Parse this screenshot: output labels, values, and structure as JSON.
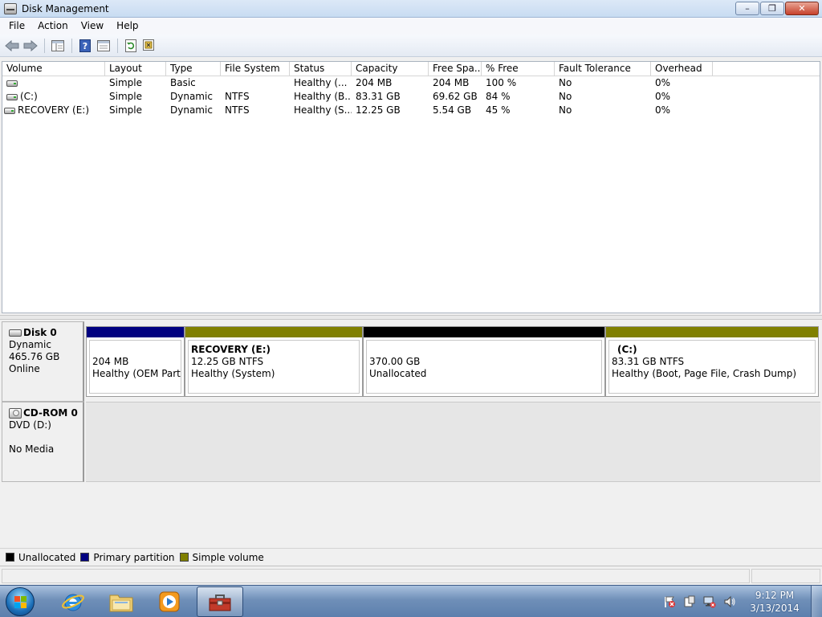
{
  "window": {
    "title": "Disk Management",
    "minimize_label": "–",
    "maximize_label": "❐",
    "close_label": "✕"
  },
  "menu": [
    "File",
    "Action",
    "View",
    "Help"
  ],
  "toolbar": {
    "icons": [
      "back-arrow-icon",
      "forward-arrow-icon",
      "show-hide-tree-icon",
      "help-icon",
      "properties-icon",
      "refresh-icon",
      "rescan-disks-icon"
    ]
  },
  "volume_list": {
    "columns": [
      "Volume",
      "Layout",
      "Type",
      "File System",
      "Status",
      "Capacity",
      "Free Spa...",
      "% Free",
      "Fault Tolerance",
      "Overhead"
    ],
    "rows": [
      {
        "volume": "",
        "layout": "Simple",
        "type": "Basic",
        "fs": "",
        "status": "Healthy (...",
        "capacity": "204 MB",
        "free": "204 MB",
        "pct_free": "100 %",
        "fault": "No",
        "overhead": "0%"
      },
      {
        "volume": "(C:)",
        "layout": "Simple",
        "type": "Dynamic",
        "fs": "NTFS",
        "status": "Healthy (B...",
        "capacity": "83.31 GB",
        "free": "69.62 GB",
        "pct_free": "84 %",
        "fault": "No",
        "overhead": "0%"
      },
      {
        "volume": "RECOVERY (E:)",
        "layout": "Simple",
        "type": "Dynamic",
        "fs": "NTFS",
        "status": "Healthy (S...",
        "capacity": "12.25 GB",
        "free": "5.54 GB",
        "pct_free": "45 %",
        "fault": "No",
        "overhead": "0%"
      }
    ]
  },
  "disks": [
    {
      "name": "Disk 0",
      "type": "Dynamic",
      "size": "465.76 GB",
      "state": "Online",
      "partitions": [
        {
          "title": "",
          "line1": "204 MB",
          "line2": "Healthy (OEM Partiti",
          "kind": "primary"
        },
        {
          "title": "RECOVERY  (E:)",
          "line1": "12.25 GB NTFS",
          "line2": "Healthy (System)",
          "kind": "simple"
        },
        {
          "title": "",
          "line1": "370.00 GB",
          "line2": "Unallocated",
          "kind": "unallocated"
        },
        {
          "title": "(C:)",
          "line1": "83.31 GB NTFS",
          "line2": "Healthy (Boot, Page File, Crash Dump)",
          "kind": "simple"
        }
      ]
    },
    {
      "name": "CD-ROM 0",
      "type": "DVD (D:)",
      "size": "",
      "state": "No Media",
      "partitions": []
    }
  ],
  "legend": [
    {
      "label": "Unallocated",
      "color": "#000000"
    },
    {
      "label": "Primary partition",
      "color": "#000080"
    },
    {
      "label": "Simple volume",
      "color": "#808000"
    }
  ],
  "colors": {
    "unallocated": "#000000",
    "primary": "#000080",
    "simple": "#808000"
  },
  "taskbar": {
    "apps": [
      "internet-explorer-icon",
      "windows-explorer-icon",
      "media-player-icon",
      "computer-management-icon"
    ],
    "clock_time": "9:12 PM",
    "clock_date": "3/13/2014"
  }
}
